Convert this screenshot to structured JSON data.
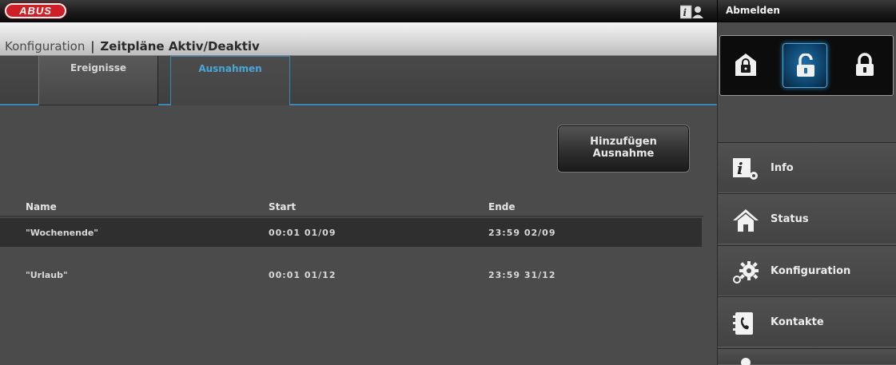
{
  "brand": {
    "logo_text": "ABUS",
    "color": "#cf1f26"
  },
  "header": {
    "logout_label": "Abmelden",
    "info_icon": "info-users-icon"
  },
  "breadcrumb": {
    "section": "Konfiguration",
    "separator": "|",
    "page": "Zeitpläne Aktiv/Deaktiv"
  },
  "tabs": [
    {
      "label": "Ereignisse",
      "active": false
    },
    {
      "label": "Ausnahmen",
      "active": true
    }
  ],
  "actions": {
    "add_exception_line1": "Hinzufügen",
    "add_exception_line2": "Ausnahme"
  },
  "table": {
    "columns": [
      "Name",
      "Start",
      "Ende"
    ],
    "rows": [
      {
        "name": "\"Wochenende\"",
        "start": "00:01 01/09",
        "end": "23:59 02/09",
        "selected": true
      },
      {
        "name": "\"Urlaub\"",
        "start": "00:01 01/12",
        "end": "23:59 31/12",
        "selected": false
      }
    ]
  },
  "lock_modes": [
    {
      "icon": "lock-home-icon",
      "active": false
    },
    {
      "icon": "lock-open-icon",
      "active": true
    },
    {
      "icon": "lock-closed-icon",
      "active": false
    }
  ],
  "sidebar": {
    "items": [
      {
        "label": "Info",
        "icon": "info-icon"
      },
      {
        "label": "Status",
        "icon": "home-icon"
      },
      {
        "label": "Konfiguration",
        "icon": "gears-icon"
      },
      {
        "label": "Kontakte",
        "icon": "contacts-icon"
      },
      {
        "label": "",
        "icon": "user-icon"
      }
    ]
  },
  "colors": {
    "accent": "#3a87b6",
    "active_tab_text": "#4aa6d8"
  }
}
